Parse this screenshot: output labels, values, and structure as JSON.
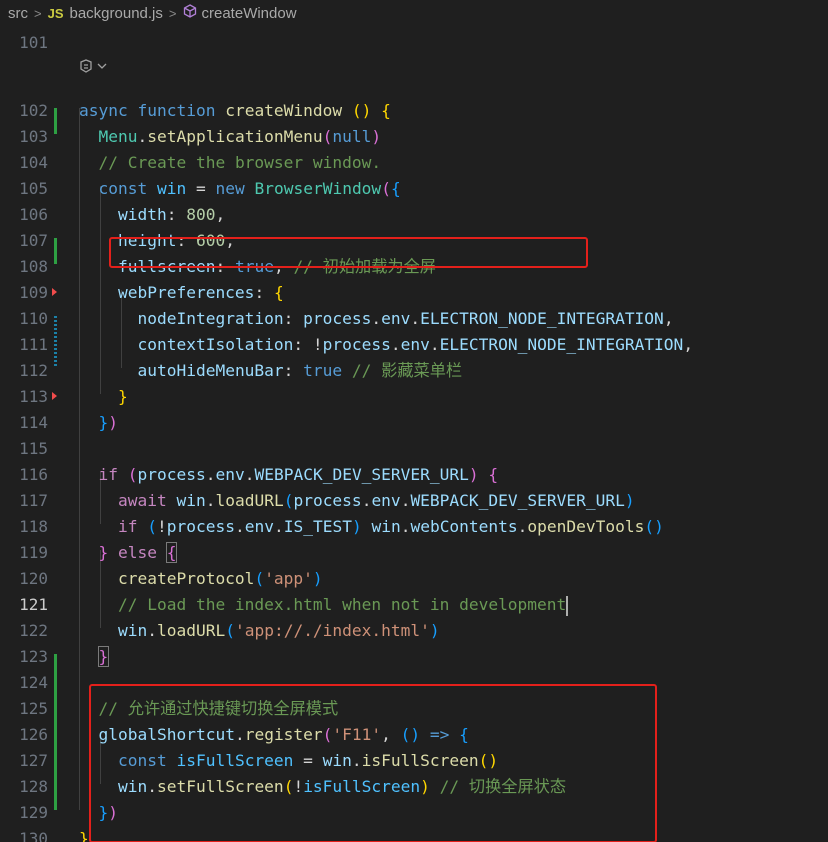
{
  "breadcrumb": {
    "folder": "src",
    "file_badge": "JS",
    "file": "background.js",
    "symbol": "createWindow"
  },
  "editor": {
    "active_line": "121",
    "line_numbers": [
      "101",
      "102",
      "103",
      "104",
      "105",
      "106",
      "107",
      "108",
      "109",
      "110",
      "111",
      "112",
      "113",
      "114",
      "115",
      "116",
      "117",
      "118",
      "119",
      "120",
      "121",
      "122",
      "123",
      "124",
      "125",
      "126",
      "127",
      "128",
      "129",
      "130"
    ],
    "code_lines": [
      {
        "ln": "101",
        "tokens": []
      },
      {
        "ln": "102",
        "tokens": [
          {
            "c": "kw",
            "t": "async"
          },
          {
            "c": "txt",
            "t": " "
          },
          {
            "c": "kw",
            "t": "function"
          },
          {
            "c": "txt",
            "t": " "
          },
          {
            "c": "fn",
            "t": "createWindow"
          },
          {
            "c": "txt",
            "t": " "
          },
          {
            "c": "br1",
            "t": "()"
          },
          {
            "c": "txt",
            "t": " "
          },
          {
            "c": "br1",
            "t": "{"
          }
        ]
      },
      {
        "ln": "103",
        "tokens": [
          {
            "c": "txt",
            "t": "  "
          },
          {
            "c": "cls",
            "t": "Menu"
          },
          {
            "c": "txt",
            "t": "."
          },
          {
            "c": "fn",
            "t": "setApplicationMenu"
          },
          {
            "c": "br2",
            "t": "("
          },
          {
            "c": "kw",
            "t": "null"
          },
          {
            "c": "br2",
            "t": ")"
          }
        ]
      },
      {
        "ln": "104",
        "tokens": [
          {
            "c": "txt",
            "t": "  "
          },
          {
            "c": "cm",
            "t": "// Create the browser window."
          }
        ]
      },
      {
        "ln": "105",
        "tokens": [
          {
            "c": "txt",
            "t": "  "
          },
          {
            "c": "kw",
            "t": "const"
          },
          {
            "c": "txt",
            "t": " "
          },
          {
            "c": "cst",
            "t": "win"
          },
          {
            "c": "txt",
            "t": " = "
          },
          {
            "c": "kw",
            "t": "new"
          },
          {
            "c": "txt",
            "t": " "
          },
          {
            "c": "cls",
            "t": "BrowserWindow"
          },
          {
            "c": "br2",
            "t": "("
          },
          {
            "c": "br3",
            "t": "{"
          }
        ]
      },
      {
        "ln": "106",
        "tokens": [
          {
            "c": "txt",
            "t": "    "
          },
          {
            "c": "var",
            "t": "width"
          },
          {
            "c": "txt",
            "t": ": "
          },
          {
            "c": "num",
            "t": "800"
          },
          {
            "c": "txt",
            "t": ","
          }
        ]
      },
      {
        "ln": "107",
        "tokens": [
          {
            "c": "txt",
            "t": "    "
          },
          {
            "c": "var",
            "t": "height"
          },
          {
            "c": "txt",
            "t": ": "
          },
          {
            "c": "num",
            "t": "600"
          },
          {
            "c": "txt",
            "t": ","
          }
        ]
      },
      {
        "ln": "108",
        "tokens": [
          {
            "c": "txt",
            "t": "    "
          },
          {
            "c": "var",
            "t": "fullscreen"
          },
          {
            "c": "txt",
            "t": ": "
          },
          {
            "c": "kw",
            "t": "true"
          },
          {
            "c": "txt",
            "t": ", "
          },
          {
            "c": "cm",
            "t": "// 初始加载为全屏"
          }
        ]
      },
      {
        "ln": "109",
        "tokens": [
          {
            "c": "txt",
            "t": "    "
          },
          {
            "c": "var",
            "t": "webPreferences"
          },
          {
            "c": "txt",
            "t": ": "
          },
          {
            "c": "br1",
            "t": "{"
          }
        ]
      },
      {
        "ln": "110",
        "tokens": [
          {
            "c": "txt",
            "t": "      "
          },
          {
            "c": "var",
            "t": "nodeIntegration"
          },
          {
            "c": "txt",
            "t": ": "
          },
          {
            "c": "var",
            "t": "process"
          },
          {
            "c": "txt",
            "t": "."
          },
          {
            "c": "var",
            "t": "env"
          },
          {
            "c": "txt",
            "t": "."
          },
          {
            "c": "var",
            "t": "ELECTRON_NODE_INTEGRATION"
          },
          {
            "c": "txt",
            "t": ","
          }
        ]
      },
      {
        "ln": "111",
        "tokens": [
          {
            "c": "txt",
            "t": "      "
          },
          {
            "c": "var",
            "t": "contextIsolation"
          },
          {
            "c": "txt",
            "t": ": !"
          },
          {
            "c": "var",
            "t": "process"
          },
          {
            "c": "txt",
            "t": "."
          },
          {
            "c": "var",
            "t": "env"
          },
          {
            "c": "txt",
            "t": "."
          },
          {
            "c": "var",
            "t": "ELECTRON_NODE_INTEGRATION"
          },
          {
            "c": "txt",
            "t": ","
          }
        ]
      },
      {
        "ln": "112",
        "tokens": [
          {
            "c": "txt",
            "t": "      "
          },
          {
            "c": "var",
            "t": "autoHideMenuBar"
          },
          {
            "c": "txt",
            "t": ": "
          },
          {
            "c": "kw",
            "t": "true"
          },
          {
            "c": "txt",
            "t": " "
          },
          {
            "c": "cm",
            "t": "// 影藏菜单栏"
          }
        ]
      },
      {
        "ln": "113",
        "tokens": [
          {
            "c": "txt",
            "t": "    "
          },
          {
            "c": "br1",
            "t": "}"
          }
        ]
      },
      {
        "ln": "114",
        "tokens": [
          {
            "c": "txt",
            "t": "  "
          },
          {
            "c": "br3",
            "t": "}"
          },
          {
            "c": "br2",
            "t": ")"
          }
        ]
      },
      {
        "ln": "115",
        "tokens": []
      },
      {
        "ln": "116",
        "tokens": [
          {
            "c": "txt",
            "t": "  "
          },
          {
            "c": "ctl",
            "t": "if"
          },
          {
            "c": "txt",
            "t": " "
          },
          {
            "c": "br2",
            "t": "("
          },
          {
            "c": "var",
            "t": "process"
          },
          {
            "c": "txt",
            "t": "."
          },
          {
            "c": "var",
            "t": "env"
          },
          {
            "c": "txt",
            "t": "."
          },
          {
            "c": "var",
            "t": "WEBPACK_DEV_SERVER_URL"
          },
          {
            "c": "br2",
            "t": ")"
          },
          {
            "c": "txt",
            "t": " "
          },
          {
            "c": "br2",
            "t": "{"
          }
        ]
      },
      {
        "ln": "117",
        "tokens": [
          {
            "c": "txt",
            "t": "    "
          },
          {
            "c": "ctl",
            "t": "await"
          },
          {
            "c": "txt",
            "t": " "
          },
          {
            "c": "var",
            "t": "win"
          },
          {
            "c": "txt",
            "t": "."
          },
          {
            "c": "fn",
            "t": "loadURL"
          },
          {
            "c": "br3",
            "t": "("
          },
          {
            "c": "var",
            "t": "process"
          },
          {
            "c": "txt",
            "t": "."
          },
          {
            "c": "var",
            "t": "env"
          },
          {
            "c": "txt",
            "t": "."
          },
          {
            "c": "var",
            "t": "WEBPACK_DEV_SERVER_URL"
          },
          {
            "c": "br3",
            "t": ")"
          }
        ]
      },
      {
        "ln": "118",
        "tokens": [
          {
            "c": "txt",
            "t": "    "
          },
          {
            "c": "ctl",
            "t": "if"
          },
          {
            "c": "txt",
            "t": " "
          },
          {
            "c": "br3",
            "t": "("
          },
          {
            "c": "txt",
            "t": "!"
          },
          {
            "c": "var",
            "t": "process"
          },
          {
            "c": "txt",
            "t": "."
          },
          {
            "c": "var",
            "t": "env"
          },
          {
            "c": "txt",
            "t": "."
          },
          {
            "c": "var",
            "t": "IS_TEST"
          },
          {
            "c": "br3",
            "t": ")"
          },
          {
            "c": "txt",
            "t": " "
          },
          {
            "c": "var",
            "t": "win"
          },
          {
            "c": "txt",
            "t": "."
          },
          {
            "c": "var",
            "t": "webContents"
          },
          {
            "c": "txt",
            "t": "."
          },
          {
            "c": "fn",
            "t": "openDevTools"
          },
          {
            "c": "br3",
            "t": "()"
          }
        ]
      },
      {
        "ln": "119",
        "tokens": [
          {
            "c": "txt",
            "t": "  "
          },
          {
            "c": "br2",
            "t": "}"
          },
          {
            "c": "txt",
            "t": " "
          },
          {
            "c": "ctl",
            "t": "else"
          },
          {
            "c": "txt",
            "t": " "
          },
          {
            "c": "br2 bm",
            "t": "{"
          }
        ]
      },
      {
        "ln": "120",
        "tokens": [
          {
            "c": "txt",
            "t": "    "
          },
          {
            "c": "fn",
            "t": "createProtocol"
          },
          {
            "c": "br3",
            "t": "("
          },
          {
            "c": "str",
            "t": "'app'"
          },
          {
            "c": "br3",
            "t": ")"
          }
        ]
      },
      {
        "ln": "121",
        "tokens": [
          {
            "c": "txt",
            "t": "    "
          },
          {
            "c": "cm",
            "t": "// Load the index.html when not in development"
          }
        ],
        "cursor": true
      },
      {
        "ln": "122",
        "tokens": [
          {
            "c": "txt",
            "t": "    "
          },
          {
            "c": "var",
            "t": "win"
          },
          {
            "c": "txt",
            "t": "."
          },
          {
            "c": "fn",
            "t": "loadURL"
          },
          {
            "c": "br3",
            "t": "("
          },
          {
            "c": "str",
            "t": "'app://./index.html'"
          },
          {
            "c": "br3",
            "t": ")"
          }
        ]
      },
      {
        "ln": "123",
        "tokens": [
          {
            "c": "txt",
            "t": "  "
          },
          {
            "c": "br2 bm",
            "t": "}"
          }
        ]
      },
      {
        "ln": "124",
        "tokens": []
      },
      {
        "ln": "125",
        "tokens": [
          {
            "c": "txt",
            "t": "  "
          },
          {
            "c": "cm",
            "t": "// 允许通过快捷键切换全屏模式"
          }
        ]
      },
      {
        "ln": "126",
        "tokens": [
          {
            "c": "txt",
            "t": "  "
          },
          {
            "c": "var",
            "t": "globalShortcut"
          },
          {
            "c": "txt",
            "t": "."
          },
          {
            "c": "fn",
            "t": "register"
          },
          {
            "c": "br2",
            "t": "("
          },
          {
            "c": "str",
            "t": "'F11'"
          },
          {
            "c": "txt",
            "t": ", "
          },
          {
            "c": "br3",
            "t": "()"
          },
          {
            "c": "txt",
            "t": " "
          },
          {
            "c": "kw",
            "t": "=>"
          },
          {
            "c": "txt",
            "t": " "
          },
          {
            "c": "br3",
            "t": "{"
          }
        ]
      },
      {
        "ln": "127",
        "tokens": [
          {
            "c": "txt",
            "t": "    "
          },
          {
            "c": "kw",
            "t": "const"
          },
          {
            "c": "txt",
            "t": " "
          },
          {
            "c": "cst",
            "t": "isFullScreen"
          },
          {
            "c": "txt",
            "t": " = "
          },
          {
            "c": "var",
            "t": "win"
          },
          {
            "c": "txt",
            "t": "."
          },
          {
            "c": "fn",
            "t": "isFullScreen"
          },
          {
            "c": "br1",
            "t": "()"
          }
        ]
      },
      {
        "ln": "128",
        "tokens": [
          {
            "c": "txt",
            "t": "    "
          },
          {
            "c": "var",
            "t": "win"
          },
          {
            "c": "txt",
            "t": "."
          },
          {
            "c": "fn",
            "t": "setFullScreen"
          },
          {
            "c": "br1",
            "t": "("
          },
          {
            "c": "txt",
            "t": "!"
          },
          {
            "c": "cst",
            "t": "isFullScreen"
          },
          {
            "c": "br1",
            "t": ")"
          },
          {
            "c": "txt",
            "t": " "
          },
          {
            "c": "cm",
            "t": "// 切换全屏状态"
          }
        ]
      },
      {
        "ln": "129",
        "tokens": [
          {
            "c": "txt",
            "t": "  "
          },
          {
            "c": "br3",
            "t": "}"
          },
          {
            "c": "br2",
            "t": ")"
          }
        ]
      },
      {
        "ln": "130",
        "tokens": [
          {
            "c": "br1",
            "t": "}"
          }
        ]
      }
    ]
  }
}
